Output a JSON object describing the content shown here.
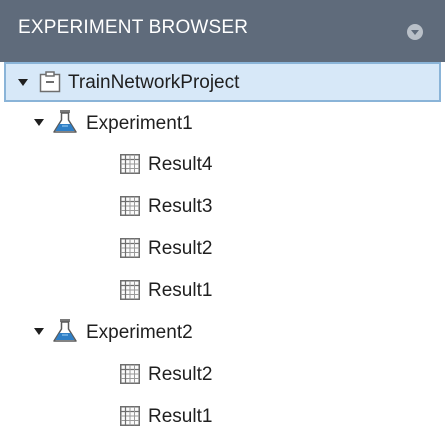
{
  "panel": {
    "title": "EXPERIMENT BROWSER"
  },
  "tree": {
    "project": {
      "label": "TrainNetworkProject",
      "icon": "project-folder-icon",
      "expanded": true,
      "selected": true
    },
    "experiments": [
      {
        "label": "Experiment1",
        "icon": "flask-icon",
        "expanded": true,
        "results": [
          {
            "label": "Result4",
            "icon": "table-icon"
          },
          {
            "label": "Result3",
            "icon": "table-icon"
          },
          {
            "label": "Result2",
            "icon": "table-icon"
          },
          {
            "label": "Result1",
            "icon": "table-icon"
          }
        ]
      },
      {
        "label": "Experiment2",
        "icon": "flask-icon",
        "expanded": true,
        "results": [
          {
            "label": "Result2",
            "icon": "table-icon"
          },
          {
            "label": "Result1",
            "icon": "table-icon"
          }
        ]
      }
    ]
  },
  "colors": {
    "header_bg": "#5f6b7b",
    "selection_bg": "#d7e8f8",
    "selection_border": "#8ab4d8",
    "flask_blue": "#2f7fc6"
  }
}
